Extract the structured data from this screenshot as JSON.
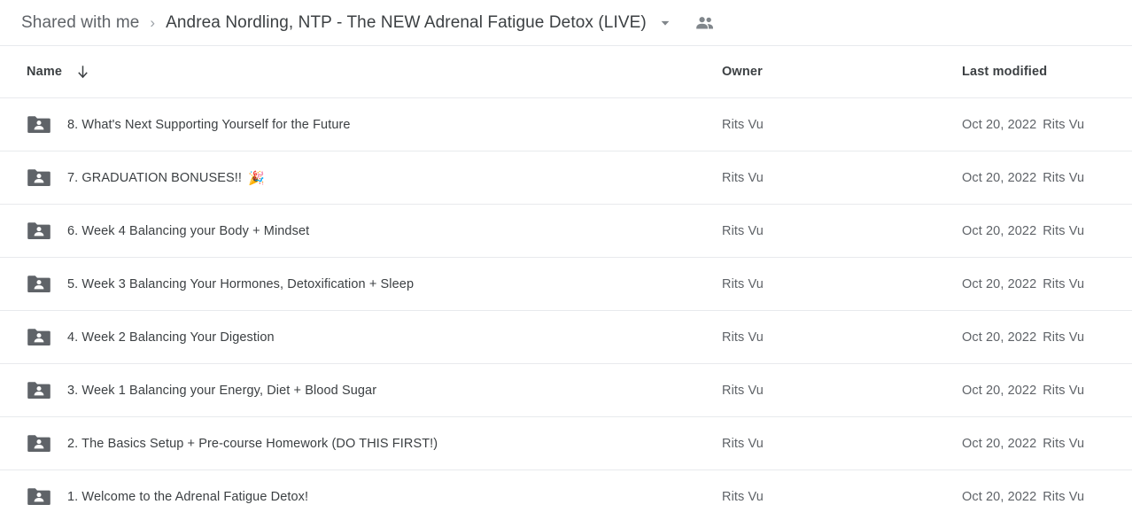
{
  "breadcrumb": {
    "parent_label": "Shared with me",
    "separator": "›",
    "current_label": "Andrea Nordling, NTP - The NEW Adrenal Fatigue Detox (LIVE)",
    "caret_icon": "chevron-down-icon",
    "people_icon": "people-shared-icon"
  },
  "columns": {
    "name": "Name",
    "owner": "Owner",
    "last_modified": "Last modified",
    "sort_icon": "arrow-down-icon",
    "sort_direction": "descending"
  },
  "colors": {
    "text_primary": "#3c4043",
    "text_secondary": "#5f6368",
    "divider": "#e8eaed",
    "folder_icon": "#5f6368",
    "background": "#ffffff"
  },
  "files": [
    {
      "name": "8. What's Next Supporting Yourself for the Future",
      "emoji": "",
      "icon": "shared-folder-icon",
      "owner": "Rits Vu",
      "modified_date": "Oct 20, 2022",
      "modified_by": "Rits Vu"
    },
    {
      "name": "7. GRADUATION BONUSES!!",
      "emoji": "🎉",
      "icon": "shared-folder-icon",
      "owner": "Rits Vu",
      "modified_date": "Oct 20, 2022",
      "modified_by": "Rits Vu"
    },
    {
      "name": "6. Week 4 Balancing your Body + Mindset",
      "emoji": "",
      "icon": "shared-folder-icon",
      "owner": "Rits Vu",
      "modified_date": "Oct 20, 2022",
      "modified_by": "Rits Vu"
    },
    {
      "name": "5. Week 3 Balancing Your Hormones, Detoxification + Sleep",
      "emoji": "",
      "icon": "shared-folder-icon",
      "owner": "Rits Vu",
      "modified_date": "Oct 20, 2022",
      "modified_by": "Rits Vu"
    },
    {
      "name": "4. Week 2 Balancing Your Digestion",
      "emoji": "",
      "icon": "shared-folder-icon",
      "owner": "Rits Vu",
      "modified_date": "Oct 20, 2022",
      "modified_by": "Rits Vu"
    },
    {
      "name": "3. Week 1 Balancing your Energy, Diet + Blood Sugar",
      "emoji": "",
      "icon": "shared-folder-icon",
      "owner": "Rits Vu",
      "modified_date": "Oct 20, 2022",
      "modified_by": "Rits Vu"
    },
    {
      "name": "2. The Basics Setup + Pre-course Homework (DO THIS FIRST!)",
      "emoji": "",
      "icon": "shared-folder-icon",
      "owner": "Rits Vu",
      "modified_date": "Oct 20, 2022",
      "modified_by": "Rits Vu"
    },
    {
      "name": "1. Welcome to the Adrenal Fatigue Detox!",
      "emoji": "",
      "icon": "shared-folder-icon",
      "owner": "Rits Vu",
      "modified_date": "Oct 20, 2022",
      "modified_by": "Rits Vu"
    }
  ]
}
